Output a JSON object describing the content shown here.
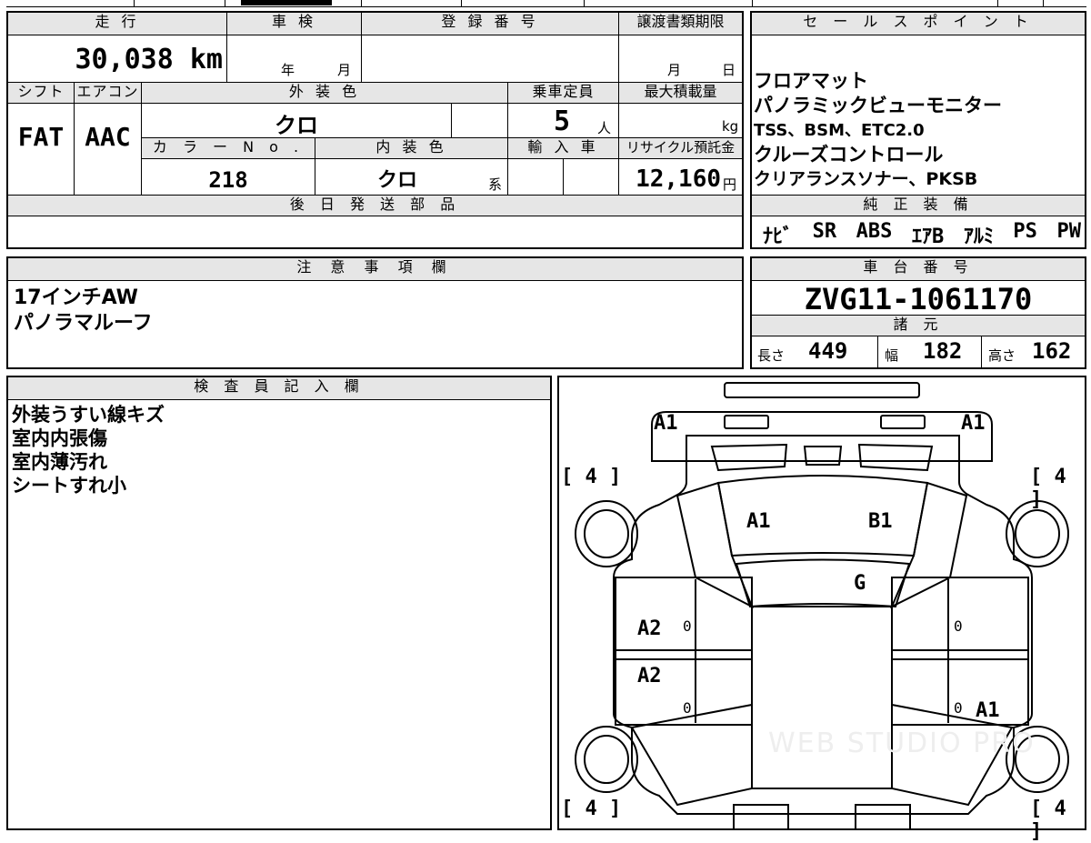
{
  "main_table": {
    "mileage_header": "走 行",
    "mileage": "30,038 km",
    "shaken_header": "車 検",
    "shaken_year": "年",
    "shaken_month": "月",
    "reg_header": "登 録 番 号",
    "transfer_header": "譲渡書類期限",
    "transfer_month": "月",
    "transfer_day": "日",
    "shift_header": "シフト",
    "ac_header": "エアコン",
    "shift": "FAT",
    "ac": "AAC",
    "exterior_header": "外 装 色",
    "exterior_color": "クロ",
    "capacity_header": "乗車定員",
    "capacity": "5",
    "capacity_unit": "人",
    "maxload_header": "最大積載量",
    "maxload_unit": "kg",
    "colorno_header": "カ ラ ー N o .",
    "color_no": "218",
    "interior_header": "内 装 色",
    "interior_color": "クロ",
    "interior_suffix": "系",
    "import_header": "輸 入 車",
    "recycle_header": "リサイクル預託金",
    "recycle_value": "12,160",
    "recycle_unit": "円",
    "later_parts_header": "後 日 発 送 部 品"
  },
  "sales_points": {
    "header": "セ ー ル ス ポ イ ン ト",
    "items": [
      "フロアマット",
      "パノラミックビューモニター",
      "TSS、BSM、ETC2.0",
      "クルーズコントロール",
      "クリアランスソナー、PKSB"
    ],
    "equip_header": "純 正 装 備",
    "equipment": [
      "ﾅﾋﾞ",
      "SR",
      "ABS",
      "ｴｱB",
      "ｱﾙﾐ",
      "PS",
      "PW"
    ]
  },
  "notes": {
    "header": "注 意 事 項 欄",
    "lines": [
      "17インチAW",
      "パノラマルーフ"
    ]
  },
  "chassis": {
    "header": "車 台 番 号",
    "number": "ZVG11-1061170",
    "spec_header": "諸 元",
    "length_label": "長さ",
    "length": "449",
    "width_label": "幅",
    "width": "182",
    "height_label": "高さ",
    "height": "162"
  },
  "inspector": {
    "header": "検 査 員 記 入 欄",
    "lines": [
      "外装うすい線キズ",
      "室内内張傷",
      "室内薄汚れ",
      "シートすれ小"
    ]
  },
  "diagram": {
    "front_left": "A1",
    "front_right": "A1",
    "tire_tl": "[ 4 ]",
    "tire_tr": "[ 4 ]",
    "tire_bl": "[ 4 ]",
    "tire_br": "[ 4 ]",
    "hood_left": "A1",
    "hood_right": "B1",
    "windshield": "G",
    "left_front_door": "A2",
    "left_rear_door": "A2",
    "right_rear_door": "A1",
    "door_mark_lf": "0",
    "door_mark_lr": "0",
    "door_mark_rf": "0",
    "door_mark_rr": "0",
    "watermark": "WEB STUDIO PRO"
  }
}
